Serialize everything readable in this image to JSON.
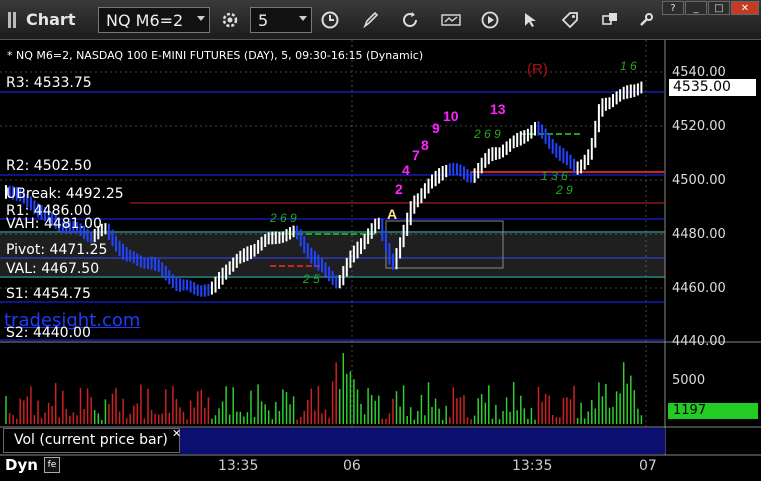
{
  "toolbar": {
    "title": "Chart",
    "symbol": "NQ M6=2",
    "interval": "5"
  },
  "chart": {
    "description": "* NQ M6=2, NASDAQ 100 E-MINI FUTURES (DAY), 5, 09:30-16:15 (Dynamic)",
    "current_price": "4535.00",
    "current_volume": "1197",
    "volume_label": "Vol (current price bar)",
    "watermark": "tradesight.com",
    "dyn_label": "Dyn",
    "pivot_labels": {
      "r3": "R3: 4533.75",
      "r2": "R2: 4502.50",
      "ubreak": "UBreak: 4492.25",
      "r1": "R1: 4486.00",
      "vah": "VAH: 4481.00",
      "pivot": "Pivot: 4471.25",
      "val": "VAL: 4467.50",
      "s1": "S1: 4454.75",
      "s2": "S2: 4440.00"
    },
    "marker_r": "(R)",
    "marker_a": "A",
    "count_labels": [
      "2",
      "4",
      "7",
      "8",
      "9",
      "10",
      "13"
    ],
    "price_axis": [
      "4540.00",
      "4520.00",
      "4500.00",
      "4480.00",
      "4460.00",
      "4440.00"
    ],
    "volume_axis": [
      "5000"
    ],
    "time_axis": [
      "13:35",
      "06",
      "13:35",
      "07"
    ]
  },
  "colors": {
    "pivot_blue": "#1a2cff",
    "pivot_red": "#cc2222",
    "value_area_cyan": "#3fd0d0",
    "magenta": "#ff22ff",
    "green_count": "#22aa22",
    "up_bar": "#ffffff",
    "down_bar": "#2244ff",
    "vol_up": "#2fcf2f",
    "vol_down": "#cc2222"
  }
}
